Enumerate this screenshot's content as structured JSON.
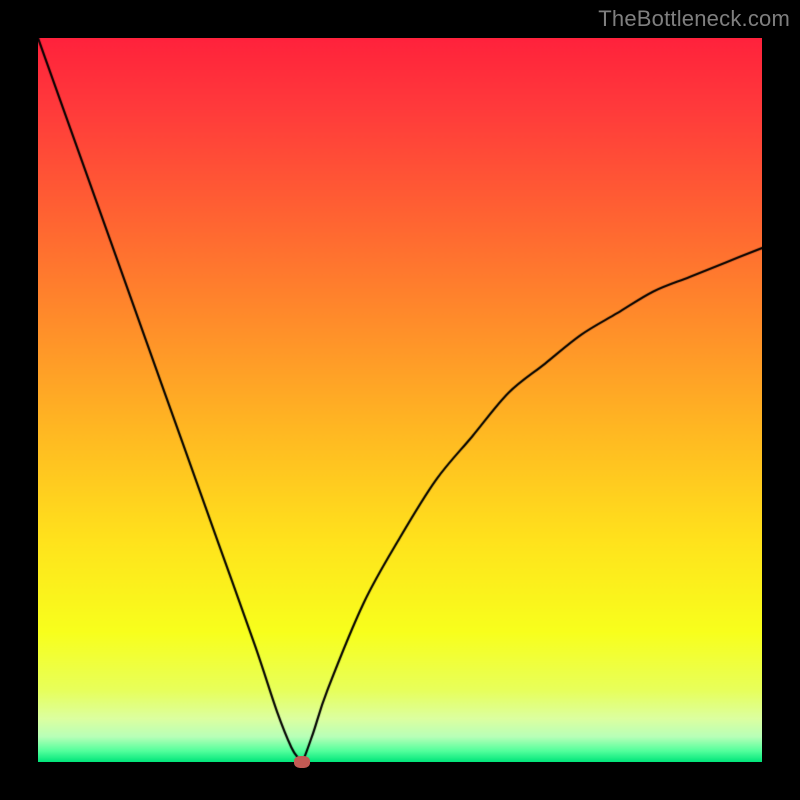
{
  "watermark": "TheBottleneck.com",
  "chart_data": {
    "type": "line",
    "title": "",
    "xlabel": "",
    "ylabel": "",
    "xlim": [
      0,
      100
    ],
    "ylim": [
      0,
      100
    ],
    "grid": false,
    "legend": false,
    "series": [
      {
        "name": "bottleneck-curve",
        "x": [
          0,
          5,
          10,
          15,
          20,
          25,
          30,
          33,
          35,
          36,
          36.5,
          38,
          40,
          45,
          50,
          55,
          60,
          65,
          70,
          75,
          80,
          85,
          90,
          95,
          100
        ],
        "y": [
          100,
          86,
          72,
          58,
          44,
          30,
          16,
          7,
          2,
          0.5,
          0,
          4,
          10,
          22,
          31,
          39,
          45,
          51,
          55,
          59,
          62,
          65,
          67,
          69,
          71
        ]
      }
    ],
    "annotations": [
      {
        "name": "optimal-marker",
        "x": 36.5,
        "y": 0,
        "color": "#c25a54"
      }
    ],
    "background_gradient": {
      "stops": [
        {
          "pos": 0.0,
          "color": "#ff223c"
        },
        {
          "pos": 0.1,
          "color": "#ff3b3b"
        },
        {
          "pos": 0.25,
          "color": "#ff6432"
        },
        {
          "pos": 0.4,
          "color": "#ff8f2a"
        },
        {
          "pos": 0.55,
          "color": "#ffba22"
        },
        {
          "pos": 0.7,
          "color": "#ffe41c"
        },
        {
          "pos": 0.82,
          "color": "#f8ff1c"
        },
        {
          "pos": 0.9,
          "color": "#e8ff5a"
        },
        {
          "pos": 0.94,
          "color": "#dcffa0"
        },
        {
          "pos": 0.965,
          "color": "#b8ffb8"
        },
        {
          "pos": 0.985,
          "color": "#52ff9c"
        },
        {
          "pos": 1.0,
          "color": "#00e57a"
        }
      ]
    }
  }
}
